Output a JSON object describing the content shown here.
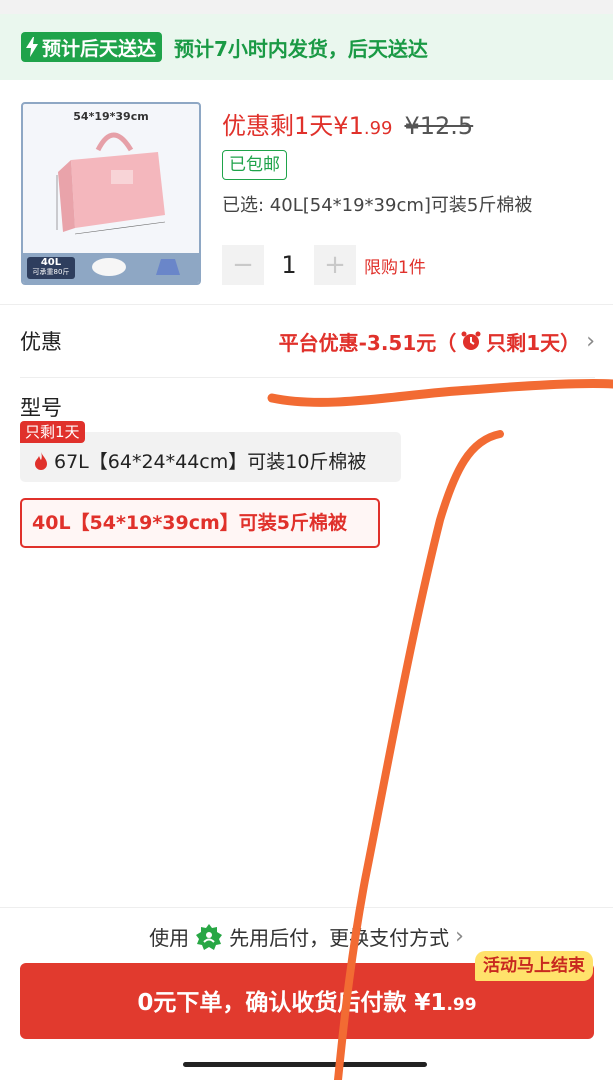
{
  "shipping": {
    "badge": "预计后天送达",
    "text": "预计7小时内发货，后天送达"
  },
  "product": {
    "thumb_dims": "54*19*39cm",
    "thumb_capacity": "40L",
    "thumb_capacity_sub": "可承重80斤",
    "price_label": "优惠剩1天",
    "price_currency": "¥",
    "price_int": "1",
    "price_dec": ".99",
    "original_price": "¥12.5",
    "free_shipping": "已包邮",
    "selected": "已选: 40L[54*19*39cm]可装5斤棉被",
    "quantity": "1",
    "minus_symbol": "−",
    "plus_symbol": "+",
    "limit": "限购1件"
  },
  "promo": {
    "label": "优惠",
    "value_main": "平台优惠-3.51元（",
    "value_tail": "只剩1天）",
    "chevron": "›"
  },
  "model": {
    "label": "型号",
    "options": [
      {
        "badge": "只剩1天",
        "text": "67L【64*24*44cm】可装10斤棉被"
      },
      {
        "text": "40L【54*19*39cm】可装5斤棉被",
        "selected": true
      }
    ]
  },
  "payment": {
    "prefix": "使用",
    "method": "先用后付，更换支付方式",
    "chevron": "›",
    "deal_tag": "活动马上结束",
    "order_main": "0元下单，确认收货后付款 ¥1",
    "order_dec": ".99"
  },
  "colors": {
    "accent_red": "#e0312b",
    "green": "#1fa34a",
    "annotation_orange": "#f26b33"
  }
}
